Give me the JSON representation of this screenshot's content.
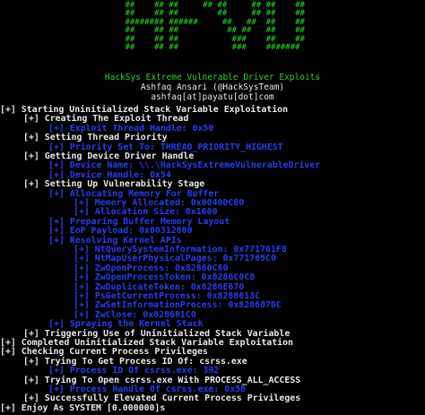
{
  "window": {
    "banner_lines": [
      " ##    ##  #######  ##     ## ####### ",
      " ##    ## ##     ## ##     ## ##    ##",
      " ##    ## ##        ##     ## ##    ##",
      " ######## ######     ##   ##  ##    ##",
      " ##    ## ##          ## ##   ##    ##",
      " ##    ## ##           ###    ##    ##",
      " ##    ## ##           ###    ####### "
    ],
    "credits": [
      "HackSys Extreme Vulnerable Driver Exploits",
      "Ashfaq Ansari (@HackSysTeam)",
      "ashfaq[at]payatu[dot]com"
    ],
    "log": [
      {
        "text": "[+] Starting Uninitialized Stack Variable Exploitation",
        "indent": 0,
        "color": "white"
      },
      {
        "text": "[+] Creating The Exploit Thread",
        "indent": 1,
        "color": "white"
      },
      {
        "text": "[+] Exploit Thread Handle: 0x50",
        "indent": 2,
        "color": "blue"
      },
      {
        "text": "[+] Setting Thread Priority",
        "indent": 1,
        "color": "white"
      },
      {
        "text": "[+] Priority Set To: THREAD_PRIORITY_HIGHEST",
        "indent": 2,
        "color": "blue"
      },
      {
        "text": "[+] Getting Device Driver Handle",
        "indent": 1,
        "color": "white"
      },
      {
        "text": "[+] Device Name: \\\\.\\HackSysExtremeVulnerableDriver",
        "indent": 2,
        "color": "blue"
      },
      {
        "text": "[+] Device Handle: 0x54",
        "indent": 2,
        "color": "blue"
      },
      {
        "text": "[+] Setting Up Vulnerability Stage",
        "indent": 1,
        "color": "white"
      },
      {
        "text": "[+] Allocating Memory For Buffer",
        "indent": 2,
        "color": "blue"
      },
      {
        "text": "[+] Memory Allocated: 0x0040DC80",
        "indent": 3,
        "color": "blue"
      },
      {
        "text": "[+] Allocation Size: 0x1000",
        "indent": 3,
        "color": "blue"
      },
      {
        "text": "[+] Preparing Buffer Memory Layout",
        "indent": 2,
        "color": "blue"
      },
      {
        "text": "[+] EoP Payload: 0x00312800",
        "indent": 2,
        "color": "blue"
      },
      {
        "text": "[+] Resolving Kernel APIs",
        "indent": 2,
        "color": "blue"
      },
      {
        "text": "[+] NtQuerySystemInformation: 0x771761F8",
        "indent": 3,
        "color": "blue"
      },
      {
        "text": "[+] NtMapUserPhysicalPages: 0x771765C0",
        "indent": 3,
        "color": "blue"
      },
      {
        "text": "[+] ZwOpenProcess: 0x82860C80",
        "indent": 3,
        "color": "blue"
      },
      {
        "text": "[+] ZwOpenProcessToken: 0x8286C0C8",
        "indent": 3,
        "color": "blue"
      },
      {
        "text": "[+] ZwDuplicateToken: 0x8286E670",
        "indent": 3,
        "color": "blue"
      },
      {
        "text": "[+] PsGetCurrentProcess: 0x8288613C",
        "indent": 3,
        "color": "blue"
      },
      {
        "text": "[+] ZwSetInformationProcess: 0x828687DC",
        "indent": 3,
        "color": "blue"
      },
      {
        "text": "[+] ZwClose: 0x828681C0",
        "indent": 3,
        "color": "blue"
      },
      {
        "text": "[+] Spraying the Kernel Stack",
        "indent": 2,
        "color": "blue"
      },
      {
        "text": "[+] Triggering Use of Uninitialized Stack Variable",
        "indent": 1,
        "color": "white"
      },
      {
        "text": "[+] Completed Uninitialized Stack Variable Exploitation",
        "indent": 0,
        "color": "white"
      },
      {
        "text": "[+] Checking Current Process Privileges",
        "indent": 0,
        "color": "white"
      },
      {
        "text": "[+] Trying To Get Process ID Of: csrss.exe",
        "indent": 1,
        "color": "white"
      },
      {
        "text": "[+] Process ID Of csrss.exe: 392",
        "indent": 2,
        "color": "blue"
      },
      {
        "text": "[+] Trying To Open csrss.exe With PROCESS_ALL_ACCESS",
        "indent": 1,
        "color": "white"
      },
      {
        "text": "[+] Process Handle Of csrss.exe: 0x58",
        "indent": 2,
        "color": "blue"
      },
      {
        "text": "[+] Successfully Elevated Current Process Privileges",
        "indent": 1,
        "color": "white"
      },
      {
        "text": "[+] Enjoy As SYSTEM [0.000000]s",
        "indent": 0,
        "color": "white"
      }
    ]
  },
  "colors": {
    "background": "#000000",
    "banner": "#22e022",
    "credits": "#2bd42b",
    "white": "#e8e8e8",
    "blue": "#2a3cf0"
  }
}
